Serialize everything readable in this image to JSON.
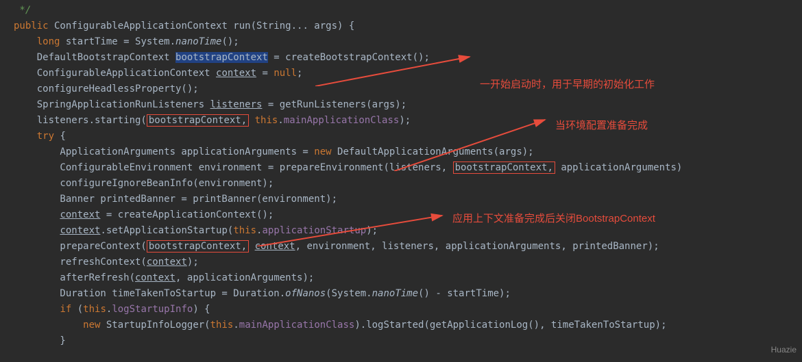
{
  "code": {
    "l1": " */",
    "l2a": "public",
    "l2b": " ConfigurableApplicationContext ",
    "l2c": "run",
    "l2d": "(String... args) {",
    "l3a": "    ",
    "l3b": "long",
    "l3c": " startTime = System.",
    "l3d": "nanoTime",
    "l3e": "();",
    "l4a": "    DefaultBootstrapContext ",
    "l4b": "bootstrapContext",
    "l4c": " = createBootstrapContext();",
    "l5a": "    ConfigurableApplicationContext ",
    "l5b": "context",
    "l5c": " = ",
    "l5d": "null",
    "l5e": ";",
    "l6a": "    configureHeadlessProperty();",
    "l7a": "    SpringApplicationRunListeners ",
    "l7b": "listeners",
    "l7c": " = getRunListeners(args);",
    "l8a": "    listeners.starting(",
    "l8b": "bootstrapContext,",
    "l8c": " ",
    "l8d": "this",
    "l8e": ".",
    "l8f": "mainApplicationClass",
    "l8g": ");",
    "l9a": "    ",
    "l9b": "try",
    "l9c": " {",
    "l10a": "        ApplicationArguments applicationArguments = ",
    "l10b": "new",
    "l10c": " DefaultApplicationArguments(args);",
    "l11a": "        ConfigurableEnvironment environment = prepareEnvironment(listeners, ",
    "l11b": "bootstrapContext,",
    "l11c": " applicationArguments)",
    "l12a": "        configureIgnoreBeanInfo(environment);",
    "l13a": "        Banner printedBanner = printBanner(environment);",
    "l14a": "        ",
    "l14b": "context",
    "l14c": " = createApplicationContext();",
    "l15a": "        ",
    "l15b": "context",
    "l15c": ".setApplicationStartup(",
    "l15d": "this",
    "l15e": ".",
    "l15f": "applicationStartup",
    "l15g": ");",
    "l16a": "        prepareContext(",
    "l16b": "bootstrapContext,",
    "l16c": " ",
    "l16d": "context",
    "l16e": ", environment, listeners, applicationArguments, printedBanner);",
    "l17a": "        refreshContext(",
    "l17b": "context",
    "l17c": ");",
    "l18a": "        afterRefresh(",
    "l18b": "context",
    "l18c": ", applicationArguments);",
    "l19a": "        Duration timeTakenToStartup = Duration.",
    "l19b": "ofNanos",
    "l19c": "(System.",
    "l19d": "nanoTime",
    "l19e": "() - startTime);",
    "l20a": "        ",
    "l20b": "if",
    "l20c": " (",
    "l20d": "this",
    "l20e": ".",
    "l20f": "logStartupInfo",
    "l20g": ") {",
    "l21a": "            ",
    "l21b": "new",
    "l21c": " StartupInfoLogger(",
    "l21d": "this",
    "l21e": ".",
    "l21f": "mainApplicationClass",
    "l21g": ").logStarted(getApplicationLog(), timeTakenToStartup);",
    "l22a": "        }"
  },
  "annotations": {
    "a1": "一开始启动时，用于早期的初始化工作",
    "a2": "当环境配置准备完成",
    "a3": "应用上下文准备完成后关闭BootstrapContext"
  },
  "watermark": "Huazie"
}
